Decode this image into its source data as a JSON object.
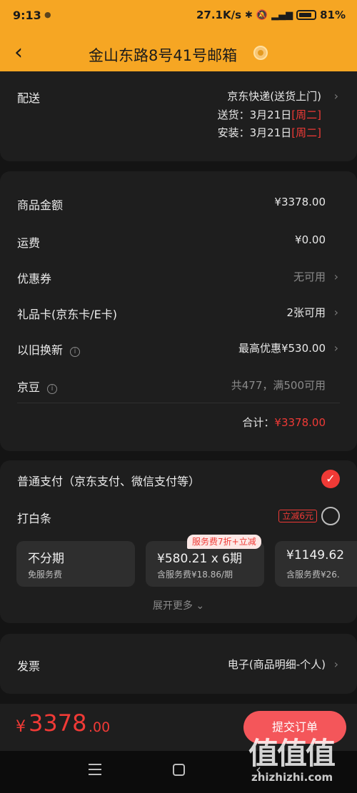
{
  "status_bar": {
    "time": "9:13",
    "network_speed": "27.1K/s",
    "battery": "81%"
  },
  "header": {
    "back": "‹",
    "title": "金山东路8号41号邮箱"
  },
  "delivery": {
    "label": "配送",
    "method": "京东快递(送货上门)",
    "ship_label": "送货：",
    "ship_date": "3月21日",
    "ship_weekday": "[周二]",
    "install_label": "安装：",
    "install_date": "3月21日",
    "install_weekday": "[周二]"
  },
  "price": {
    "goods_label": "商品金额",
    "goods_value": "¥3378.00",
    "shipping_label": "运费",
    "shipping_value": "¥0.00",
    "coupon_label": "优惠券",
    "coupon_value": "无可用",
    "giftcard_label": "礼品卡(京东卡/E卡)",
    "giftcard_value": "2张可用",
    "tradein_label": "以旧换新",
    "tradein_value": "最高优惠¥530.00",
    "jdbean_label": "京豆",
    "jdbean_value": "共477，满500可用",
    "total_label": "合计：",
    "total_value": "¥3378.00"
  },
  "payment": {
    "normal_label": "普通支付（京东支付、微信支付等）",
    "baitiao_label": "打白条",
    "baitiao_promo": "立减6元",
    "installments": [
      {
        "main": "不分期",
        "sub": "免服务费"
      },
      {
        "main": "¥580.21 x 6期",
        "sub": "含服务费¥18.86/期"
      },
      {
        "main": "¥1149.62",
        "sub": "含服务费¥26."
      }
    ],
    "badge": "服务费7折+立减",
    "expand": "展开更多"
  },
  "invoice": {
    "label": "发票",
    "value": "电子(商品明细-个人)"
  },
  "footer": {
    "currency": "¥",
    "total_int": "3378",
    "total_dec": ".00",
    "submit": "提交订单"
  },
  "watermark": {
    "logo": "值值值",
    "url": "zhizhizhi.com"
  },
  "chevron": "›",
  "colors": {
    "header": "#f6a623",
    "accent_red": "#f03a36",
    "background": "#141414",
    "card": "#1e1e1e"
  }
}
